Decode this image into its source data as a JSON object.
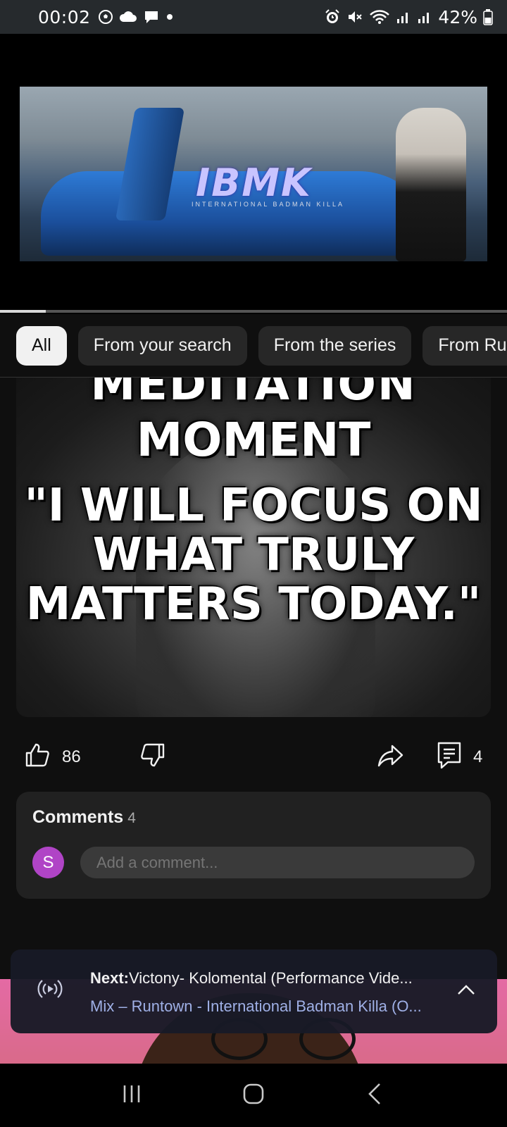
{
  "status_bar": {
    "time": "00:02",
    "battery_percent": "42%",
    "icons_left": [
      "soccer-icon",
      "cloud-icon",
      "chat-icon",
      "dot-icon"
    ],
    "icons_right": [
      "alarm-icon",
      "mute-icon",
      "wifi-icon",
      "signal-icon",
      "signal-icon",
      "battery-icon"
    ]
  },
  "player": {
    "video_logo": "IBMK",
    "video_subtitle": "INTERNATIONAL BADMAN KILLA",
    "progress_fraction": 0.09
  },
  "chips": [
    {
      "label": "All",
      "active": true
    },
    {
      "label": "From your search",
      "active": false
    },
    {
      "label": "From the series",
      "active": false
    },
    {
      "label": "From Ru",
      "active": false
    }
  ],
  "thumbnail": {
    "line1": "MEDITATION",
    "line2": "MOMENT",
    "line3": "\"I WILL FOCUS ON",
    "line4": "WHAT TRULY",
    "line5": "MATTERS TODAY.\""
  },
  "actions": {
    "like_count": "86",
    "comment_count": "4"
  },
  "comments": {
    "title": "Comments",
    "count": "4",
    "avatar_initial": "S",
    "avatar_color": "#b044c6",
    "input_placeholder": "Add a comment..."
  },
  "up_next": {
    "label": "Next:",
    "title": "Victony- Kolomental (Performance Vide...",
    "playlist": "Mix – Runtown - International Badman Killa (O..."
  }
}
